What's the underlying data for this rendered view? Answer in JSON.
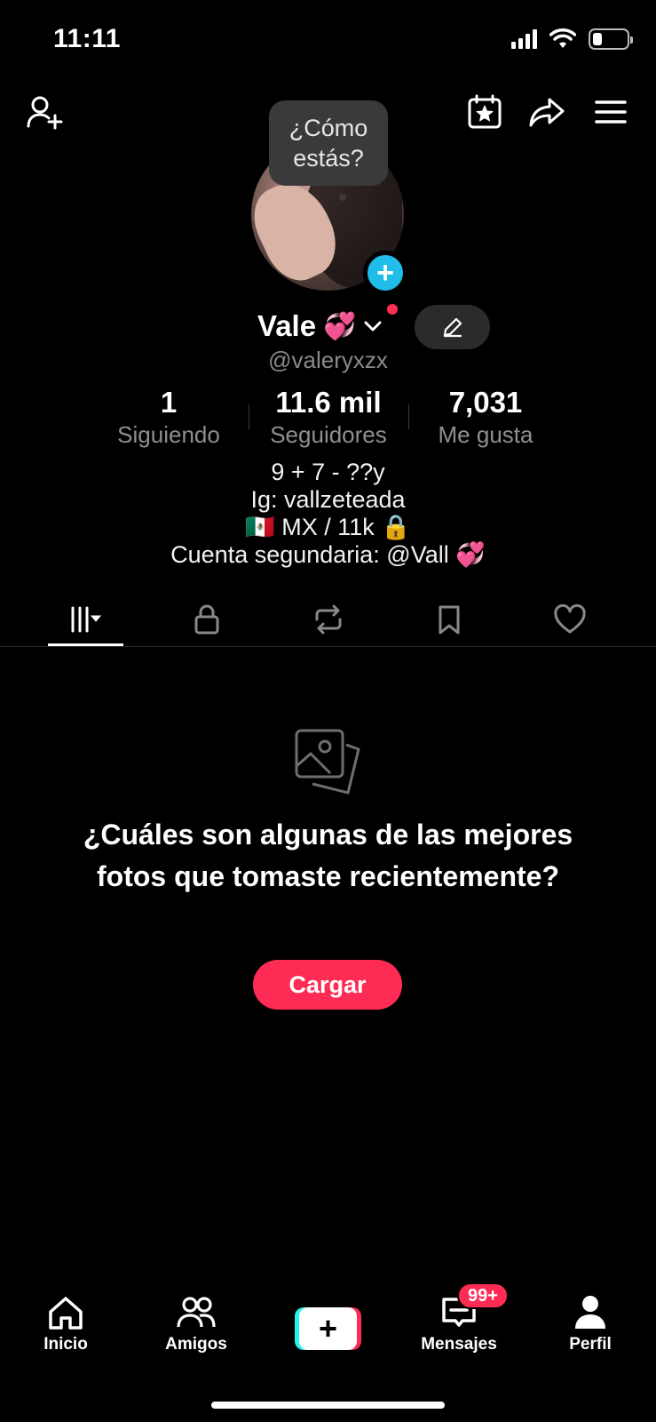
{
  "status_bar": {
    "time": "11:11"
  },
  "profile": {
    "mood_prompt_line1": "¿Cómo",
    "mood_prompt_line2": "estás?",
    "name": "Vale",
    "name_emoji": "💞",
    "username": "@valeryxzx"
  },
  "stats": [
    {
      "value": "1",
      "label": "Siguiendo"
    },
    {
      "value": "11.6 mil",
      "label": "Seguidores"
    },
    {
      "value": "7,031",
      "label": "Me gusta"
    }
  ],
  "bio": [
    "9 + 7 - ??y",
    "Ig: vallzeteada",
    "🇲🇽 MX / 11k 🔒",
    "Cuenta segundaria: @Vall 💞"
  ],
  "empty_state": {
    "title": "¿Cuáles son algunas de las mejores fotos que tomaste recientemente?",
    "button": "Cargar"
  },
  "bottom_nav": {
    "home": "Inicio",
    "friends": "Amigos",
    "inbox": "Mensajes",
    "inbox_badge": "99+",
    "profile": "Perfil"
  },
  "colors": {
    "accent": "#fe2c55",
    "cyan": "#25f4ee",
    "add_badge": "#21bdea",
    "muted": "#8a8a8a"
  },
  "icons": [
    "add-friend-icon",
    "calendar-star-icon",
    "share-icon",
    "menu-icon",
    "grid-icon",
    "lock-icon",
    "repost-icon",
    "bookmark-icon",
    "heart-icon",
    "photos-icon",
    "home-icon",
    "friends-icon",
    "inbox-icon",
    "profile-icon"
  ]
}
